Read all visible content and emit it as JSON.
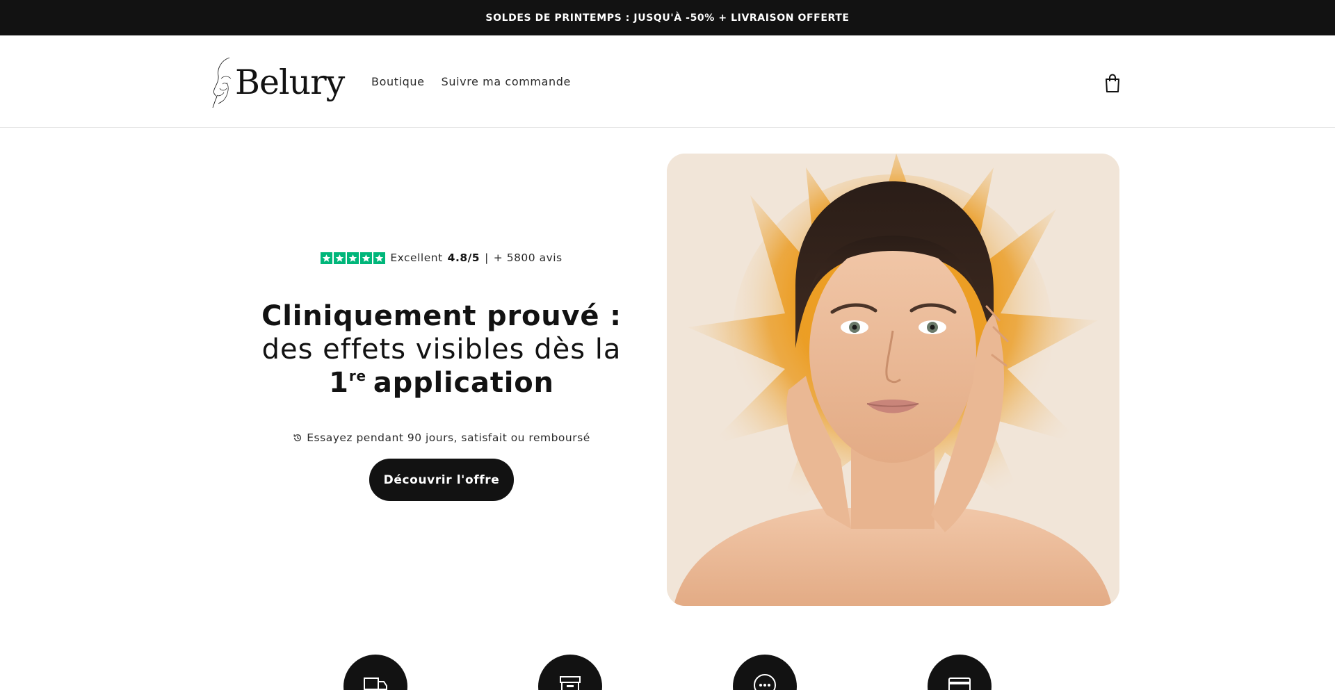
{
  "announcement": "SOLDES DE PRINTEMPS : JUSQU'À -50% + LIVRAISON OFFERTE",
  "brand": {
    "name": "Belury"
  },
  "nav": {
    "items": [
      "Boutique",
      "Suivre ma commande"
    ]
  },
  "header": {
    "cart_icon": "shopping-bag-icon"
  },
  "rating": {
    "stars": 5,
    "label": "Excellent",
    "score": "4.8/5",
    "separator": "|",
    "count": "+ 5800 avis",
    "star_color": "#00b67a"
  },
  "hero": {
    "line1": "Cliniquement prouvé :",
    "line2": "des effets visibles dès la",
    "line3_number": "1",
    "line3_sup": "re",
    "line3_rest": "application",
    "guarantee": "Essayez pendant 90 jours, satisfait ou remboursé",
    "cta": "Découvrir l'offre"
  },
  "features": {
    "icons": [
      "delivery-truck-icon",
      "box-icon",
      "chat-bubble-icon",
      "credit-card-icon"
    ]
  },
  "colors": {
    "dark": "#121212",
    "accent_orange": "#e8930f",
    "trustpilot_green": "#00b67a"
  }
}
